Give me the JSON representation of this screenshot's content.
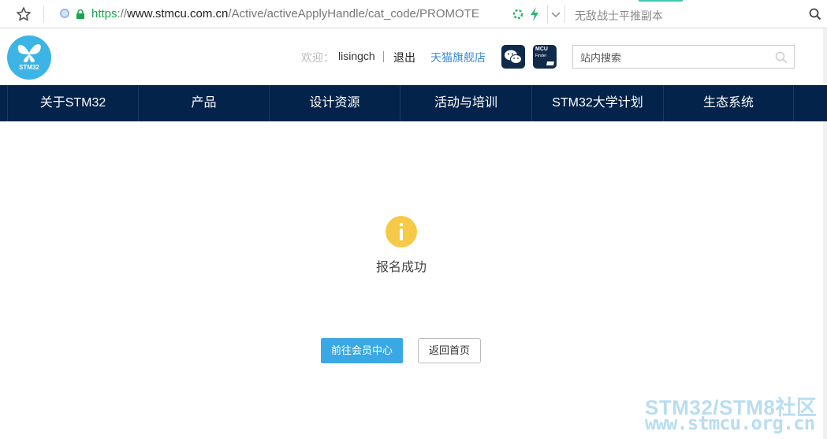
{
  "browser": {
    "url_scheme": "https",
    "url_sep": "://",
    "url_domain": "www.stmcu.com.cn",
    "url_path": "/Active/activeApplyHandle/cat_code/PROMOTE",
    "hot_word": "无敌战士平推副本"
  },
  "header": {
    "logo_text": "STM32",
    "welcome_label": "欢迎：",
    "username": "lisingch",
    "logout": "退出",
    "tmall": "天猫旗舰店",
    "mcu_badge_line1": "MCU",
    "mcu_badge_line2": "Finder",
    "search_placeholder": "站内搜索"
  },
  "nav": {
    "items": [
      "关于STM32",
      "产品",
      "设计资源",
      "活动与培训",
      "STM32大学计划",
      "生态系统"
    ]
  },
  "main": {
    "message": "报名成功",
    "primary_button": "前往会员中心",
    "secondary_button": "返回首页"
  },
  "watermark": {
    "line1": "STM32/STM8社区",
    "line2": "www.stmcu.org.cn"
  },
  "colors": {
    "nav_bg": "#03234b",
    "accent": "#3aa8e4",
    "info_icon": "#f7c948"
  }
}
